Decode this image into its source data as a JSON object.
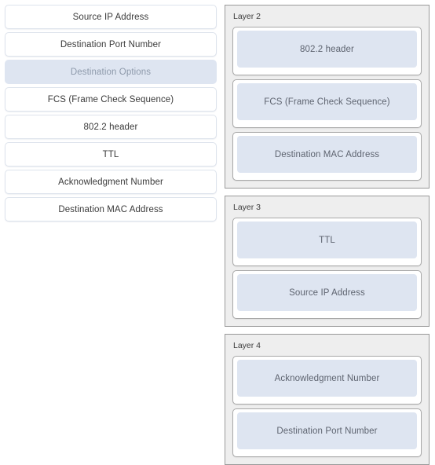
{
  "source_panel": {
    "name": "draggable-items-list",
    "items": [
      {
        "label": "Source IP Address",
        "state": "normal"
      },
      {
        "label": "Destination Port Number",
        "state": "normal"
      },
      {
        "label": "Destination Options",
        "state": "selected"
      },
      {
        "label": "FCS (Frame Check Sequence)",
        "state": "normal"
      },
      {
        "label": "802.2 header",
        "state": "normal"
      },
      {
        "label": "TTL",
        "state": "normal"
      },
      {
        "label": "Acknowledgment Number",
        "state": "normal"
      },
      {
        "label": "Destination MAC Address",
        "state": "normal"
      }
    ]
  },
  "layer_panels": [
    {
      "title": "Layer 2",
      "slots": [
        {
          "label": "802.2 header"
        },
        {
          "label": "FCS (Frame Check Sequence)"
        },
        {
          "label": "Destination MAC Address"
        }
      ]
    },
    {
      "title": "Layer 3",
      "slots": [
        {
          "label": "TTL"
        },
        {
          "label": "Source IP Address"
        }
      ]
    },
    {
      "title": "Layer 4",
      "slots": [
        {
          "label": "Acknowledgment Number"
        },
        {
          "label": "Destination Port Number"
        }
      ]
    }
  ],
  "colors": {
    "page_background": "#ffffff",
    "item_background": "#ffffff",
    "item_border": "#dde3ec",
    "selected_background": "#dee5f1",
    "selected_text": "#8e9aab",
    "panel_background": "#eeeeee",
    "panel_border": "#999999",
    "chip_background": "#dee5f1",
    "chip_text": "#5e6470",
    "item_text": "#3a3a3a",
    "title_text": "#3d3d3d"
  }
}
